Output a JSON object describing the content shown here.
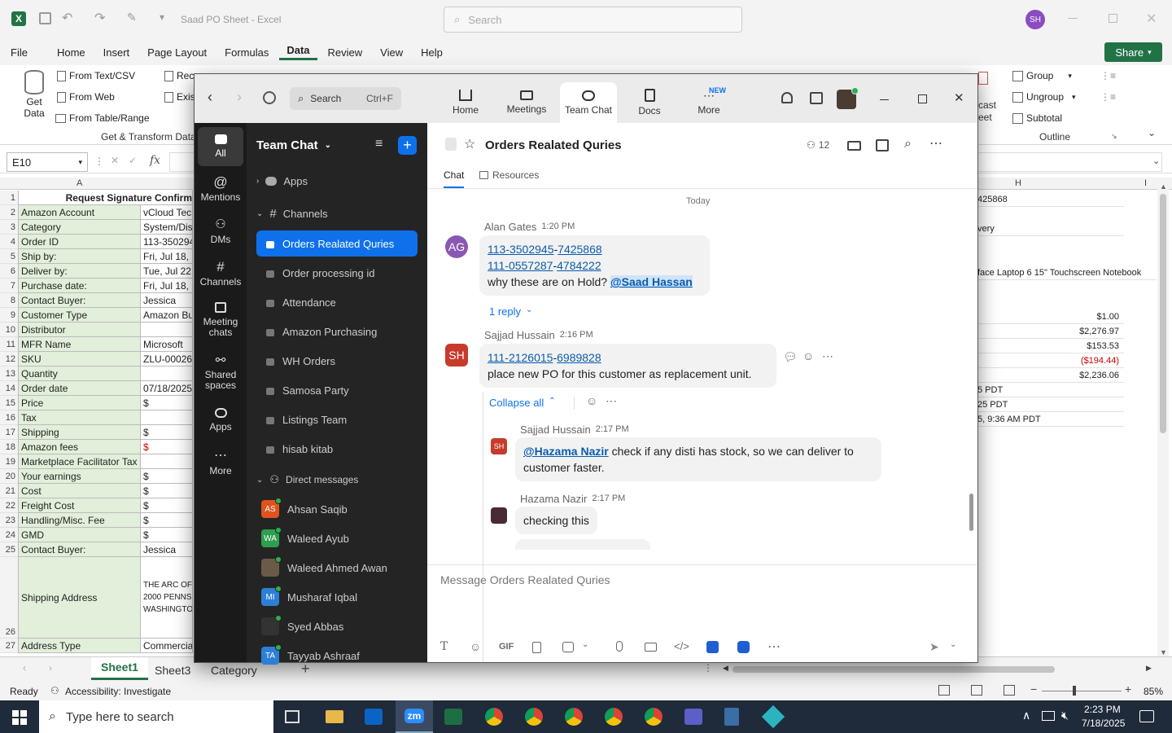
{
  "excel": {
    "title": "Saad PO Sheet  -  Excel",
    "search_placeholder": "Search",
    "user_initials": "SH",
    "share_label": "Share",
    "menus": [
      "File",
      "Home",
      "Insert",
      "Page Layout",
      "Formulas",
      "Data",
      "Review",
      "View",
      "Help"
    ],
    "active_menu": "Data",
    "ribbon": {
      "get_data": "Get\nData",
      "from_text_csv": "From Text/CSV",
      "from_web": "From Web",
      "from_table_range": "From Table/Range",
      "group_label": "Get & Transform Data",
      "rec": "Rec",
      "exis": "Exis",
      "cast": "cast",
      "eet": "eet",
      "group": "Group",
      "ungroup": "Ungroup",
      "subtotal": "Subtotal",
      "outline": "Outline"
    },
    "name_box": "E10",
    "fx": "fx",
    "col_a": "A",
    "col_h": "H",
    "col_i": "I",
    "rows": [
      {
        "n": "1",
        "a": "Request Signature Confirm",
        "b": "",
        "bold": true
      },
      {
        "n": "2",
        "a": "Amazon Account",
        "b": "vCloud Tech"
      },
      {
        "n": "3",
        "a": "Category",
        "b": "System/Dis"
      },
      {
        "n": "4",
        "a": "Order ID",
        "b": "113-350294"
      },
      {
        "n": "5",
        "a": "Ship by:",
        "b": "Fri, Jul 18, 2"
      },
      {
        "n": "6",
        "a": "Deliver by:",
        "b": "Tue, Jul 22,"
      },
      {
        "n": "7",
        "a": "Purchase date:",
        "b": "Fri, Jul 18, 2"
      },
      {
        "n": "8",
        "a": "Contact Buyer:",
        "b": "Jessica"
      },
      {
        "n": "9",
        "a": "Customer Type",
        "b": "Amazon Bu"
      },
      {
        "n": "10",
        "a": "Distributor",
        "b": ""
      },
      {
        "n": "11",
        "a": "MFR Name",
        "b": "Microsoft"
      },
      {
        "n": "12",
        "a": "SKU",
        "b": "ZLU-00026"
      },
      {
        "n": "13",
        "a": "Quantity",
        "b": ""
      },
      {
        "n": "14",
        "a": "Order date",
        "b": "07/18/2025"
      },
      {
        "n": "15",
        "a": "Price",
        "b": "$"
      },
      {
        "n": "16",
        "a": "Tax",
        "b": ""
      },
      {
        "n": "17",
        "a": "Shipping",
        "b": "$"
      },
      {
        "n": "18",
        "a": "Amazon fees",
        "b": "$"
      },
      {
        "n": "19",
        "a": "Marketplace Facilitator Tax",
        "b": ""
      },
      {
        "n": "20",
        "a": "Your earnings",
        "b": "$"
      },
      {
        "n": "21",
        "a": "Cost",
        "b": "$"
      },
      {
        "n": "22",
        "a": "Freight Cost",
        "b": "$"
      },
      {
        "n": "23",
        "a": "Handling/Misc. Fee",
        "b": "$"
      },
      {
        "n": "24",
        "a": "GMD",
        "b": "$"
      },
      {
        "n": "25",
        "a": "Contact Buyer:",
        "b": "Jessica"
      },
      {
        "n": "26",
        "a": "Shipping Address",
        "b": "THE ARC OF\n2000 PENNS\nWASHINGTO"
      },
      {
        "n": "27",
        "a": "Address Type",
        "b": "Commercia"
      }
    ],
    "col_h_cells": [
      {
        "row": "1",
        "v": "425868",
        "align": "left"
      },
      {
        "row": "3",
        "v": "very",
        "align": "left"
      },
      {
        "row": "6",
        "v": "face Laptop 6 15\" Touchscreen Notebook",
        "align": "left"
      },
      {
        "row": "9",
        "v": "$1.00",
        "align": "right"
      },
      {
        "row": "10",
        "v": "$2,276.97",
        "align": "right"
      },
      {
        "row": "11",
        "v": "$153.53",
        "align": "right"
      },
      {
        "row": "12",
        "v": "($194.44)",
        "align": "right",
        "red": true
      },
      {
        "row": "13",
        "v": "$2,236.06",
        "align": "right"
      },
      {
        "row": "14",
        "v": "5 PDT",
        "align": "left"
      },
      {
        "row": "15",
        "v": "25 PDT",
        "align": "left"
      },
      {
        "row": "16",
        "v": "5, 9:36 AM PDT",
        "align": "left"
      }
    ],
    "sheets": [
      "Sheet1",
      "Sheet3",
      "Category"
    ],
    "active_sheet": "Sheet1",
    "status_ready": "Ready",
    "accessibility": "Accessibility: Investigate",
    "zoom_level": "85%"
  },
  "taskbar": {
    "search_placeholder": "Type here to search",
    "time": "2:23 PM",
    "date": "7/18/2025",
    "zm_label": "zm"
  },
  "zoom": {
    "search_placeholder": "Search",
    "search_shortcut": "Ctrl+F",
    "tabs": [
      {
        "label": "Home",
        "icon": "home-icon"
      },
      {
        "label": "Meetings",
        "icon": "video-icon"
      },
      {
        "label": "Team Chat",
        "icon": "chat-icon"
      },
      {
        "label": "Docs",
        "icon": "doc-icon"
      },
      {
        "label": "More",
        "icon": "more-icon",
        "badge": "NEW"
      }
    ],
    "active_tab": "Team Chat",
    "rail": [
      {
        "label": "All"
      },
      {
        "label": "Mentions"
      },
      {
        "label": "DMs"
      },
      {
        "label": "Channels"
      },
      {
        "label": "Meeting chats"
      },
      {
        "label": "Shared spaces"
      },
      {
        "label": "Apps"
      },
      {
        "label": "More"
      }
    ],
    "sidebar": {
      "title": "Team Chat",
      "apps_label": "Apps",
      "channels_label": "Channels",
      "channels": [
        "Orders Realated Quries",
        "Order processing id",
        "Attendance",
        "Amazon Purchasing",
        "WH Orders",
        "Samosa Party",
        "Listings Team",
        "hisab kitab"
      ],
      "active_channel": "Orders Realated Quries",
      "dm_label": "Direct messages",
      "dms": [
        {
          "name": "Ahsan Saqib",
          "initials": "AS",
          "color": "#e0531f",
          "photo": false
        },
        {
          "name": "Waleed Ayub",
          "initials": "WA",
          "color": "#2e9e4f",
          "photo": false
        },
        {
          "name": "Waleed Ahmed Awan",
          "initials": "",
          "color": "#6b5a48",
          "photo": true
        },
        {
          "name": "Musharaf Iqbal",
          "initials": "MI",
          "color": "#2c7fd6",
          "photo": false
        },
        {
          "name": "Syed Abbas",
          "initials": "",
          "color": "#333333",
          "photo": true
        },
        {
          "name": "Tayyab Ashraaf",
          "initials": "TA",
          "color": "#2c7fd6",
          "photo": false
        }
      ]
    },
    "channel": {
      "title": "Orders Realated Quries",
      "members": "12",
      "tab_chat": "Chat",
      "tab_resources": "Resources",
      "day": "Today"
    },
    "messages": {
      "m1": {
        "initials": "AG",
        "author": "Alan Gates",
        "time": "1:20 PM",
        "l1a": "113-3502945",
        "l1b": "7425868",
        "l2a": "111-0557287",
        "l2b": "4784222",
        "text": "why these are on Hold? ",
        "mention": "@Saad Hassan",
        "reply": "1 reply"
      },
      "m2": {
        "initials": "SH",
        "author": "Sajjad Hussain",
        "time": "2:16 PM",
        "la": "111-2126015",
        "lb": "6989828",
        "text": "place new PO for this customer as replacement unit.",
        "collapse": "Collapse all"
      },
      "r1": {
        "initials": "SH",
        "author": "Sajjad Hussain",
        "time": "2:17 PM",
        "mention": "@Hazama Nazir",
        "text1": " check if any disti has stock, so we can deliver to",
        "text2": "customer faster."
      },
      "r2": {
        "author": "Hazama Nazir",
        "time": "2:17 PM",
        "text": "checking this"
      }
    },
    "composer_placeholder": "Message Orders Realated Quries",
    "gif": "GIF"
  },
  "colors": {
    "excel_green": "#217346",
    "zoom_blue": "#0e71eb",
    "link": "#0b5cad"
  }
}
